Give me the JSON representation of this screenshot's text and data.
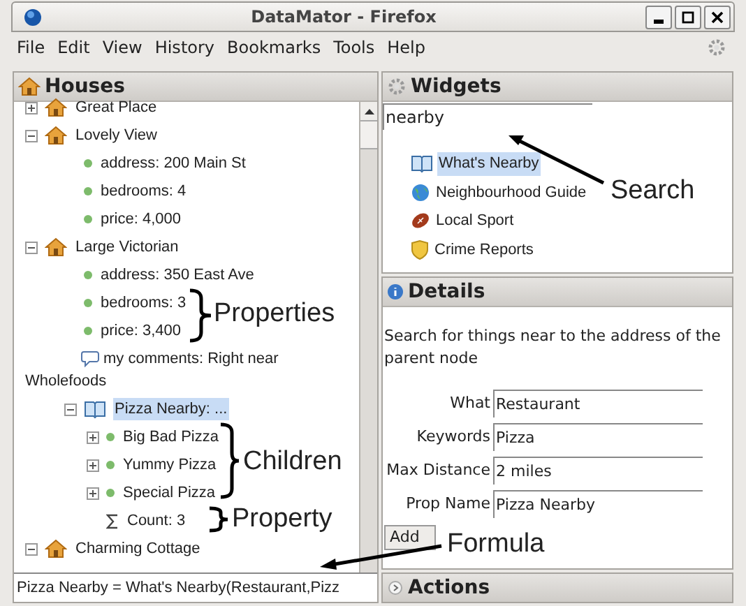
{
  "window": {
    "title": "DataMator - Firefox"
  },
  "menu": [
    "File",
    "Edit",
    "View",
    "History",
    "Bookmarks",
    "Tools",
    "Help"
  ],
  "houses": {
    "title": "Houses",
    "nodes": [
      {
        "kind": "house",
        "label": "Great Place",
        "expanded": false,
        "selected": false
      },
      {
        "kind": "house",
        "label": "Lovely View",
        "expanded": true,
        "selected": false,
        "children": [
          {
            "kind": "property",
            "label": "address: 200 Main St",
            "selected": false
          },
          {
            "kind": "property",
            "label": "bedrooms: 4",
            "selected": false
          },
          {
            "kind": "property",
            "label": "price: 4,000",
            "selected": false
          }
        ]
      },
      {
        "kind": "house",
        "label": "Large Victorian",
        "expanded": true,
        "selected": false,
        "children": [
          {
            "kind": "property",
            "label": "address: 350 East Ave",
            "selected": false
          },
          {
            "kind": "property",
            "label": "bedrooms: 3",
            "selected": false
          },
          {
            "kind": "property",
            "label": "price: 3,400",
            "selected": false
          },
          {
            "kind": "comment",
            "label": "my comments: Right near Wholefoods",
            "selected": false
          },
          {
            "kind": "widget",
            "label": "Pizza Nearby: ...",
            "expanded": true,
            "selected": true,
            "children": [
              {
                "kind": "result",
                "label": "Big Bad Pizza",
                "expanded": false,
                "selected": false
              },
              {
                "kind": "result",
                "label": "Yummy Pizza",
                "expanded": false,
                "selected": false
              },
              {
                "kind": "result",
                "label": "Special Pizza",
                "expanded": false,
                "selected": false
              },
              {
                "kind": "formula",
                "label": "Count: 3",
                "selected": false
              }
            ]
          }
        ]
      },
      {
        "kind": "house",
        "label": "Charming Cottage",
        "expanded": true,
        "selected": false
      }
    ],
    "formula": "Pizza Nearby = What's Nearby(Restaurant,Pizz"
  },
  "widgets": {
    "title": "Widgets",
    "search": "nearby",
    "items": [
      {
        "kind": "book",
        "label": "What's Nearby",
        "selected": true
      },
      {
        "kind": "globe",
        "label": "Neighbourhood Guide",
        "selected": false
      },
      {
        "kind": "ball",
        "label": "Local Sport",
        "selected": false
      },
      {
        "kind": "shield",
        "label": "Crime Reports",
        "selected": false
      }
    ]
  },
  "details": {
    "title": "Details",
    "description": "Search for things near to the address of the parent node",
    "fields": [
      {
        "label": "What",
        "value": "Restaurant"
      },
      {
        "label": "Keywords",
        "value": "Pizza"
      },
      {
        "label": "Max Distance",
        "value": "2 miles"
      },
      {
        "label": "Prop Name",
        "value": "Pizza Nearby"
      }
    ],
    "button": "Add"
  },
  "actions": {
    "title": "Actions",
    "expanded": false
  },
  "annotations": [
    {
      "kind": "arrow",
      "label": "Search"
    },
    {
      "kind": "brace",
      "label": "Properties"
    },
    {
      "kind": "brace",
      "label": "Children"
    },
    {
      "kind": "brace",
      "label": "Property"
    },
    {
      "kind": "arrow",
      "label": "Formula"
    }
  ]
}
